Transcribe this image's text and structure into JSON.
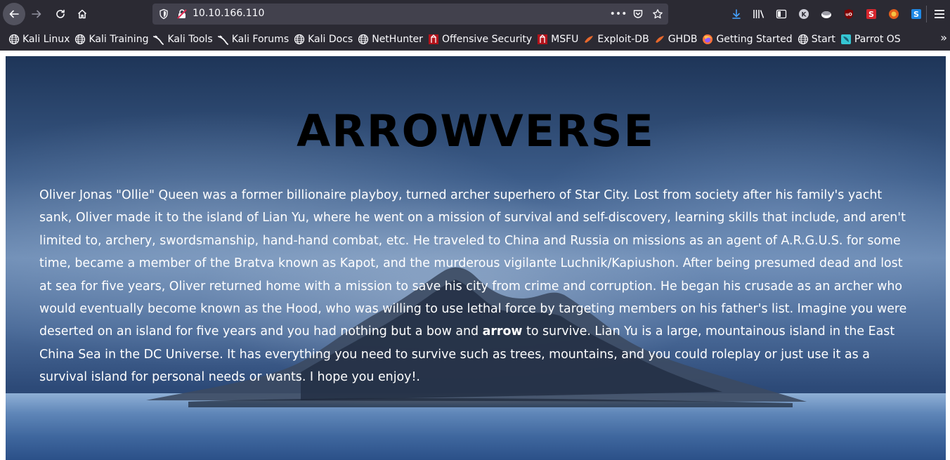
{
  "browser": {
    "url": "10.10.166.110",
    "bookmarks": [
      {
        "label": "Kali Linux",
        "icon": "globe-icon"
      },
      {
        "label": "Kali Training",
        "icon": "globe-icon"
      },
      {
        "label": "Kali Tools",
        "icon": "kali-dragon-icon"
      },
      {
        "label": "Kali Forums",
        "icon": "kali-dragon-icon"
      },
      {
        "label": "Kali Docs",
        "icon": "globe-icon"
      },
      {
        "label": "NetHunter",
        "icon": "globe-icon"
      },
      {
        "label": "Offensive Security",
        "icon": "offsec-icon"
      },
      {
        "label": "MSFU",
        "icon": "offsec-icon"
      },
      {
        "label": "Exploit-DB",
        "icon": "exploitdb-icon"
      },
      {
        "label": "GHDB",
        "icon": "exploitdb-icon"
      },
      {
        "label": "Getting Started",
        "icon": "firefox-icon"
      },
      {
        "label": "Start",
        "icon": "globe-icon"
      },
      {
        "label": "Parrot OS",
        "icon": "parrot-icon"
      }
    ],
    "colors": {
      "chrome": "#2b2a33",
      "urlbar": "#42414d",
      "accent_download": "#45a1ff"
    }
  },
  "page": {
    "title": "ARROWVERSE",
    "paragraph_before": "Oliver Jonas \"Ollie\" Queen was a former billionaire playboy, turned archer superhero of Star City. Lost from society after his family's yacht sank, Oliver made it to the island of Lian Yu, where he went on a mission of survival and self-discovery, learning skills that include, and aren't limited to, archery, swordsmanship, hand-hand combat, etc. He traveled to China and Russia on missions as an agent of A.R.G.U.S. for some time, became a member of the Bratva known as Kapot, and the murderous vigilante Luchnik/Kapiushon. After being presumed dead and lost at sea for five years, Oliver returned home with a mission to save his city from crime and corruption. He began his crusade as an archer who would eventually become known as the Hood, who was willing to use lethal force by targeting members on his father's list. Imagine you were deserted on an island for five years and you had nothing but a bow and ",
    "paragraph_bold": "arrow",
    "paragraph_after": " to survive. Lian Yu is a large, mountainous island in the East China Sea in the DC Universe. It has everything you need to survive such as trees, mountains, and you could roleplay or just use it as a survival island for personal needs or wants. I hope you enjoy!."
  }
}
